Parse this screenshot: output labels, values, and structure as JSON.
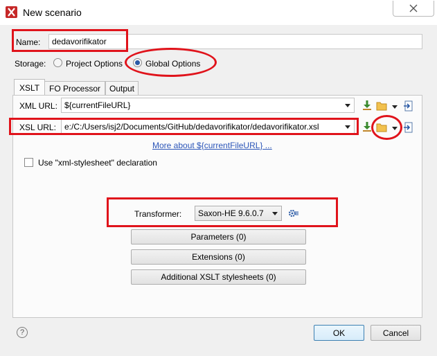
{
  "window": {
    "title": "New scenario"
  },
  "name_field": {
    "label": "Name:",
    "value": "dedavorifikator"
  },
  "storage": {
    "label": "Storage:",
    "project_option": "Project Options",
    "global_option": "Global Options",
    "selected": "Global Options"
  },
  "tabs": [
    {
      "label": "XSLT"
    },
    {
      "label": "FO Processor"
    },
    {
      "label": "Output"
    }
  ],
  "xml_url": {
    "label": "XML URL:",
    "value": "${currentFileURL}"
  },
  "xsl_url": {
    "label": "XSL URL:",
    "value": "e:/C:/Users/isj2/Documents/GitHub/dedavorifikator/dedavorifikator.xsl"
  },
  "more_link": "More about ${currentFileURL} ...",
  "xml_stylesheet_checkbox": {
    "label": "Use \"xml-stylesheet\" declaration",
    "checked": false
  },
  "transformer": {
    "label": "Transformer:",
    "value": "Saxon-HE 9.6.0.7"
  },
  "buttons": {
    "parameters": "Parameters (0)",
    "extensions": "Extensions (0)",
    "additional": "Additional XSLT stylesheets (0)",
    "ok": "OK",
    "cancel": "Cancel"
  },
  "help_icon": "?",
  "colors": {
    "highlight": "#e0131b",
    "link": "#2b55b8",
    "radio_selected": "#2a5aa6"
  }
}
